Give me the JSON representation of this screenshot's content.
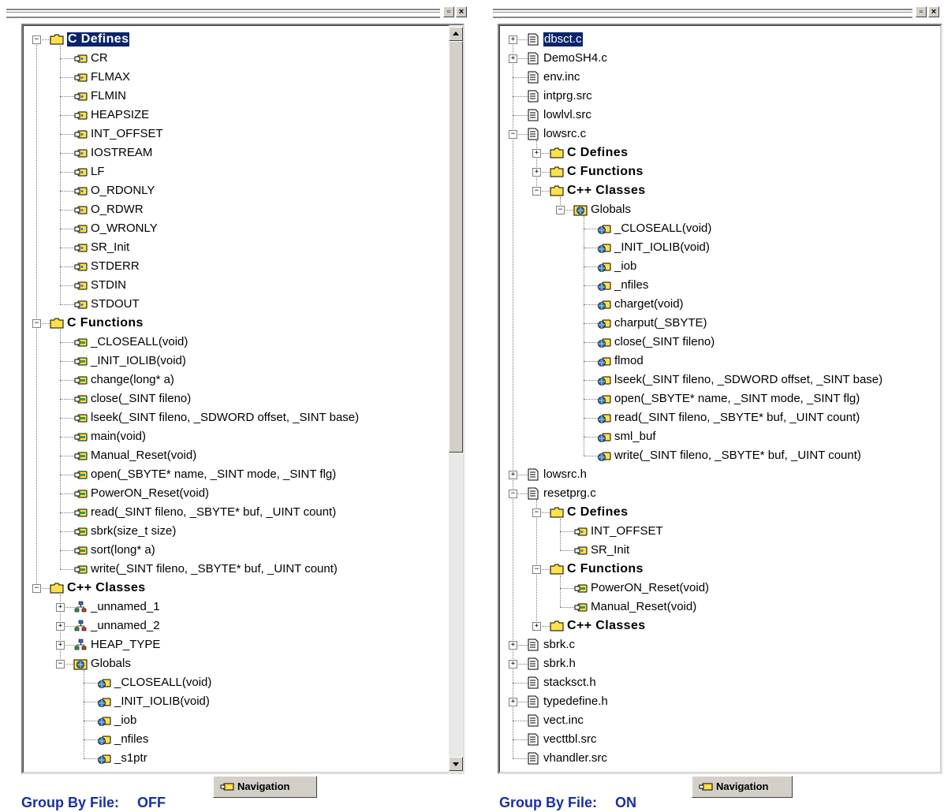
{
  "left_panel": {
    "navigation_tab_label": "Navigation",
    "footer": {
      "label": "Group By File:",
      "value": "OFF"
    },
    "tree": [
      {
        "depth": 0,
        "label": "C Defines",
        "kind": "folder",
        "expander": "−",
        "bold": true,
        "selected": true
      },
      {
        "depth": 1,
        "label": "CR",
        "kind": "define"
      },
      {
        "depth": 1,
        "label": "FLMAX",
        "kind": "define"
      },
      {
        "depth": 1,
        "label": "FLMIN",
        "kind": "define"
      },
      {
        "depth": 1,
        "label": "HEAPSIZE",
        "kind": "define"
      },
      {
        "depth": 1,
        "label": "INT_OFFSET",
        "kind": "define"
      },
      {
        "depth": 1,
        "label": "IOSTREAM",
        "kind": "define"
      },
      {
        "depth": 1,
        "label": "LF",
        "kind": "define"
      },
      {
        "depth": 1,
        "label": "O_RDONLY",
        "kind": "define"
      },
      {
        "depth": 1,
        "label": "O_RDWR",
        "kind": "define"
      },
      {
        "depth": 1,
        "label": "O_WRONLY",
        "kind": "define"
      },
      {
        "depth": 1,
        "label": "SR_Init",
        "kind": "define"
      },
      {
        "depth": 1,
        "label": "STDERR",
        "kind": "define"
      },
      {
        "depth": 1,
        "label": "STDIN",
        "kind": "define"
      },
      {
        "depth": 1,
        "label": "STDOUT",
        "kind": "define"
      },
      {
        "depth": 0,
        "label": "C Functions",
        "kind": "folder",
        "expander": "−",
        "bold": true
      },
      {
        "depth": 1,
        "label": "_CLOSEALL(void)",
        "kind": "function"
      },
      {
        "depth": 1,
        "label": "_INIT_IOLIB(void)",
        "kind": "function"
      },
      {
        "depth": 1,
        "label": "change(long* a)",
        "kind": "function"
      },
      {
        "depth": 1,
        "label": "close(_SINT fileno)",
        "kind": "function"
      },
      {
        "depth": 1,
        "label": "lseek(_SINT fileno, _SDWORD offset, _SINT base)",
        "kind": "function"
      },
      {
        "depth": 1,
        "label": "main(void)",
        "kind": "function"
      },
      {
        "depth": 1,
        "label": "Manual_Reset(void)",
        "kind": "function"
      },
      {
        "depth": 1,
        "label": "open(_SBYTE* name, _SINT mode, _SINT flg)",
        "kind": "function"
      },
      {
        "depth": 1,
        "label": "PowerON_Reset(void)",
        "kind": "function"
      },
      {
        "depth": 1,
        "label": "read(_SINT fileno, _SBYTE* buf, _UINT count)",
        "kind": "function"
      },
      {
        "depth": 1,
        "label": "sbrk(size_t size)",
        "kind": "function"
      },
      {
        "depth": 1,
        "label": "sort(long* a)",
        "kind": "function"
      },
      {
        "depth": 1,
        "label": "write(_SINT fileno, _SBYTE* buf, _UINT count)",
        "kind": "function"
      },
      {
        "depth": 0,
        "label": "C++ Classes",
        "kind": "folder",
        "expander": "−",
        "bold": true
      },
      {
        "depth": 1,
        "label": "_unnamed_1",
        "kind": "class",
        "expander": "+"
      },
      {
        "depth": 1,
        "label": "_unnamed_2",
        "kind": "class",
        "expander": "+"
      },
      {
        "depth": 1,
        "label": "HEAP_TYPE",
        "kind": "class",
        "expander": "+"
      },
      {
        "depth": 1,
        "label": "Globals",
        "kind": "globals",
        "expander": "−"
      },
      {
        "depth": 2,
        "label": "_CLOSEALL(void)",
        "kind": "global-member"
      },
      {
        "depth": 2,
        "label": "_INIT_IOLIB(void)",
        "kind": "global-member"
      },
      {
        "depth": 2,
        "label": "_iob",
        "kind": "global-member"
      },
      {
        "depth": 2,
        "label": "_nfiles",
        "kind": "global-member"
      },
      {
        "depth": 2,
        "label": "_s1ptr",
        "kind": "global-member"
      }
    ]
  },
  "right_panel": {
    "navigation_tab_label": "Navigation",
    "footer": {
      "label": "Group By File:",
      "value": "ON"
    },
    "tree": [
      {
        "depth": 0,
        "label": "dbsct.c",
        "kind": "file",
        "expander": "+",
        "selected": true
      },
      {
        "depth": 0,
        "label": "DemoSH4.c",
        "kind": "file",
        "expander": "+"
      },
      {
        "depth": 0,
        "label": "env.inc",
        "kind": "file"
      },
      {
        "depth": 0,
        "label": "intprg.src",
        "kind": "file"
      },
      {
        "depth": 0,
        "label": "lowlvl.src",
        "kind": "file"
      },
      {
        "depth": 0,
        "label": "lowsrc.c",
        "kind": "file",
        "expander": "−"
      },
      {
        "depth": 1,
        "label": "C Defines",
        "kind": "folder",
        "expander": "+",
        "bold": true
      },
      {
        "depth": 1,
        "label": "C Functions",
        "kind": "folder",
        "expander": "+",
        "bold": true
      },
      {
        "depth": 1,
        "label": "C++ Classes",
        "kind": "folder",
        "expander": "−",
        "bold": true
      },
      {
        "depth": 2,
        "label": "Globals",
        "kind": "globals",
        "expander": "−"
      },
      {
        "depth": 3,
        "label": "_CLOSEALL(void)",
        "kind": "global-member"
      },
      {
        "depth": 3,
        "label": "_INIT_IOLIB(void)",
        "kind": "global-member"
      },
      {
        "depth": 3,
        "label": "_iob",
        "kind": "global-member"
      },
      {
        "depth": 3,
        "label": "_nfiles",
        "kind": "global-member"
      },
      {
        "depth": 3,
        "label": "charget(void)",
        "kind": "global-member"
      },
      {
        "depth": 3,
        "label": "charput(_SBYTE)",
        "kind": "global-member"
      },
      {
        "depth": 3,
        "label": "close(_SINT fileno)",
        "kind": "global-member"
      },
      {
        "depth": 3,
        "label": "flmod",
        "kind": "global-member"
      },
      {
        "depth": 3,
        "label": "lseek(_SINT fileno, _SDWORD offset, _SINT base)",
        "kind": "global-member"
      },
      {
        "depth": 3,
        "label": "open(_SBYTE* name, _SINT mode, _SINT flg)",
        "kind": "global-member"
      },
      {
        "depth": 3,
        "label": "read(_SINT fileno, _SBYTE* buf, _UINT count)",
        "kind": "global-member"
      },
      {
        "depth": 3,
        "label": "sml_buf",
        "kind": "global-member"
      },
      {
        "depth": 3,
        "label": "write(_SINT fileno, _SBYTE* buf, _UINT count)",
        "kind": "global-member"
      },
      {
        "depth": 0,
        "label": "lowsrc.h",
        "kind": "file",
        "expander": "+"
      },
      {
        "depth": 0,
        "label": "resetprg.c",
        "kind": "file",
        "expander": "−"
      },
      {
        "depth": 1,
        "label": "C Defines",
        "kind": "folder",
        "expander": "−",
        "bold": true
      },
      {
        "depth": 2,
        "label": "INT_OFFSET",
        "kind": "define"
      },
      {
        "depth": 2,
        "label": "SR_Init",
        "kind": "define"
      },
      {
        "depth": 1,
        "label": "C Functions",
        "kind": "folder",
        "expander": "−",
        "bold": true
      },
      {
        "depth": 2,
        "label": "PowerON_Reset(void)",
        "kind": "function"
      },
      {
        "depth": 2,
        "label": "Manual_Reset(void)",
        "kind": "function"
      },
      {
        "depth": 1,
        "label": "C++ Classes",
        "kind": "folder",
        "expander": "+",
        "bold": true
      },
      {
        "depth": 0,
        "label": "sbrk.c",
        "kind": "file",
        "expander": "+"
      },
      {
        "depth": 0,
        "label": "sbrk.h",
        "kind": "file",
        "expander": "+"
      },
      {
        "depth": 0,
        "label": "stacksct.h",
        "kind": "file"
      },
      {
        "depth": 0,
        "label": "typedefine.h",
        "kind": "file",
        "expander": "+"
      },
      {
        "depth": 0,
        "label": "vect.inc",
        "kind": "file"
      },
      {
        "depth": 0,
        "label": "vecttbl.src",
        "kind": "file"
      },
      {
        "depth": 0,
        "label": "vhandler.src",
        "kind": "file"
      }
    ]
  },
  "colors": {
    "selection": "#0a246a",
    "footer_text": "#1a2ea8",
    "folder_yellow": "#ffe14a",
    "chrome": "#d4d0c8"
  }
}
